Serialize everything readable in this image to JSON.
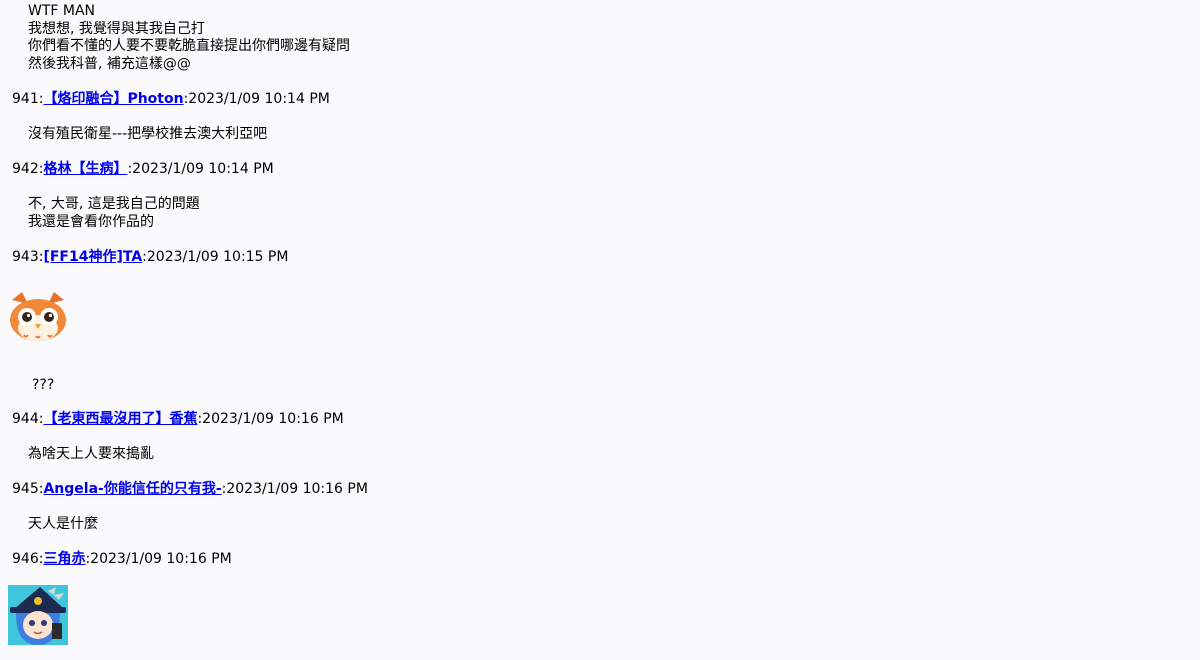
{
  "intro": {
    "lines": [
      "WTF MAN",
      "我想想, 我覺得與其我自己打",
      "你們看不懂的人要不要乾脆直接提出你們哪邊有疑問",
      "然後我科普, 補充這樣@@"
    ]
  },
  "posts": [
    {
      "no": "941:",
      "name": "【烙印融合】Photon",
      "date": ":2023/1/09 10:14 PM",
      "body": [
        "沒有殖民衛星---把學校推去澳大利亞吧"
      ]
    },
    {
      "no": "942:",
      "name": "格林【生病】",
      "date": ":2023/1/09 10:14 PM",
      "body": [
        "不, 大哥, 這是我自己的問題",
        "我還是會看你作品的"
      ]
    },
    {
      "no": "943:",
      "name": "[FF14神作]TA",
      "date": ":2023/1/09 10:15 PM",
      "body": [
        "???"
      ],
      "avatar": "owl-cat-emoticon"
    },
    {
      "no": "944:",
      "name": "【老東西最沒用了】香蕉",
      "date": ":2023/1/09 10:16 PM",
      "body": [
        "為啥天上人要來搗亂"
      ]
    },
    {
      "no": "945:",
      "name": "Angela-你能信任的只有我-",
      "date": ":2023/1/09 10:16 PM",
      "body": [
        "天人是什麼"
      ]
    },
    {
      "no": "946:",
      "name": "三角赤",
      "date": ":2023/1/09 10:16 PM",
      "body": [],
      "avatar": "witch-girl-emoticon"
    }
  ]
}
